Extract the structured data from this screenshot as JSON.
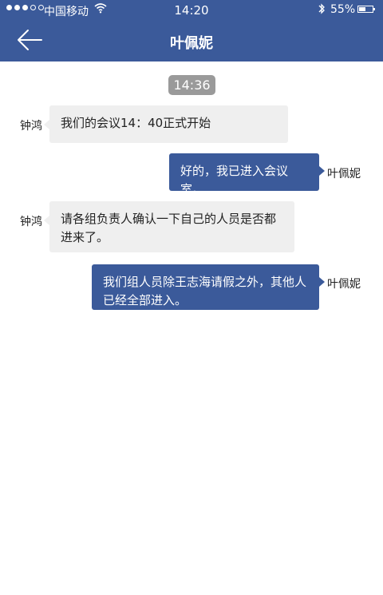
{
  "status_bar": {
    "carrier": "中国移动",
    "time": "14:20",
    "battery": "55%",
    "battery_level": 0.55
  },
  "header": {
    "title": "叶佩妮",
    "back_icon": "arrow-left-icon"
  },
  "chat": {
    "timestamp": "14:36",
    "messages": [
      {
        "sender": "钟鸿",
        "direction": "incoming",
        "text": "我们的会议14：40正式开始"
      },
      {
        "sender": "叶佩妮",
        "direction": "outgoing",
        "text": "好的，我已进入会议室。"
      },
      {
        "sender": "钟鸿",
        "direction": "incoming",
        "text": "请各组负责人确认一下自己的人员是否都进来了。"
      },
      {
        "sender": "叶佩妮",
        "direction": "outgoing",
        "text": "我们组人员除王志海请假之外，其他人已经全部进入。"
      }
    ]
  },
  "colors": {
    "brand_blue": "#3b5a9a",
    "incoming_bubble": "#efefef",
    "timestamp_badge": "#9a9a9a"
  }
}
